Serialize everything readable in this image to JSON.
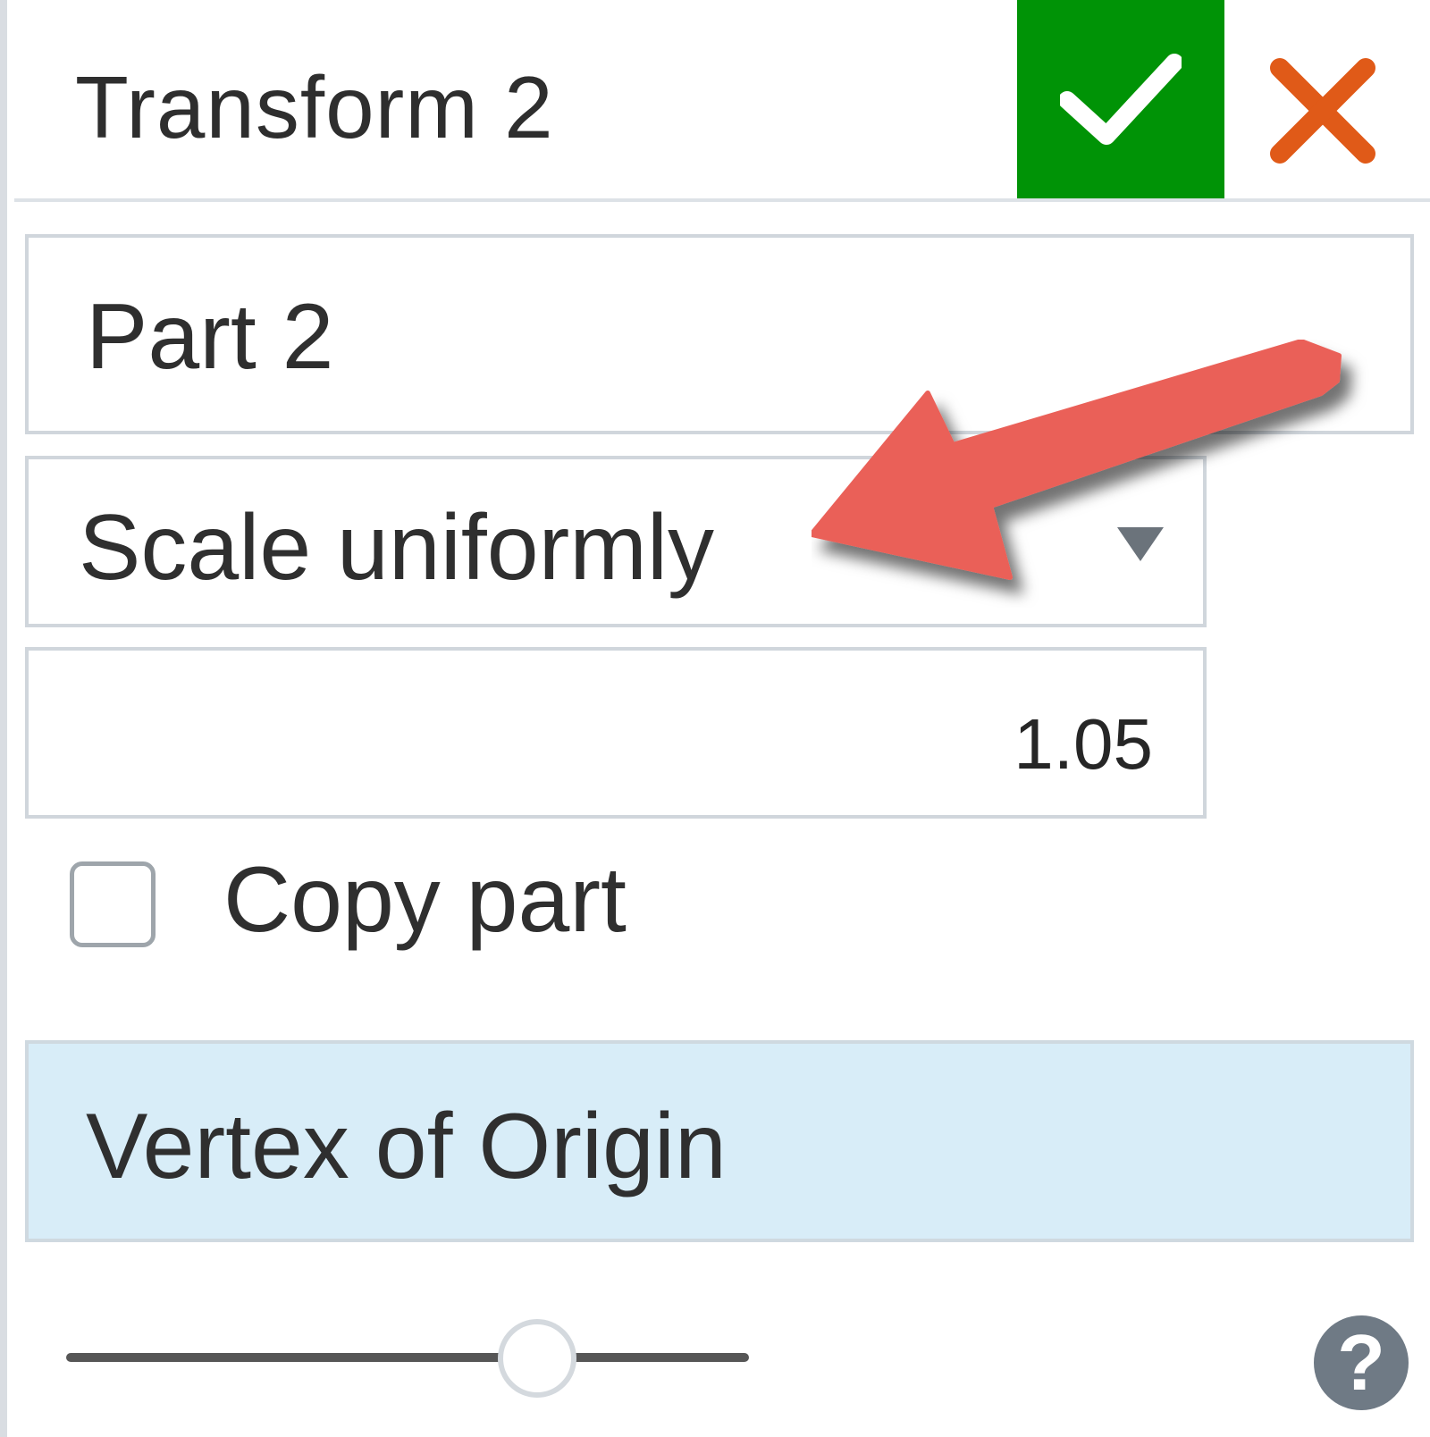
{
  "dialog": {
    "title": "Transform 2",
    "accept_icon": "checkmark-icon",
    "cancel_icon": "close-x-icon",
    "accept_color": "#009306",
    "cancel_color": "#e05a18"
  },
  "part_selection": {
    "value": "Part 2"
  },
  "transform_type": {
    "selected": "Scale uniformly",
    "icon": "triangle-down-icon"
  },
  "scale_factor": {
    "value": "1.05"
  },
  "copy_part": {
    "label": "Copy part",
    "checked": false
  },
  "point_selection": {
    "value": "Vertex of Origin",
    "highlight_color": "#d8edf8"
  },
  "slider": {
    "position_fraction": 0.69
  },
  "help": {
    "icon": "question-mark-icon",
    "glyph": "?"
  },
  "annotation": {
    "icon": "red-arrow-icon",
    "color": "#ea6159"
  }
}
